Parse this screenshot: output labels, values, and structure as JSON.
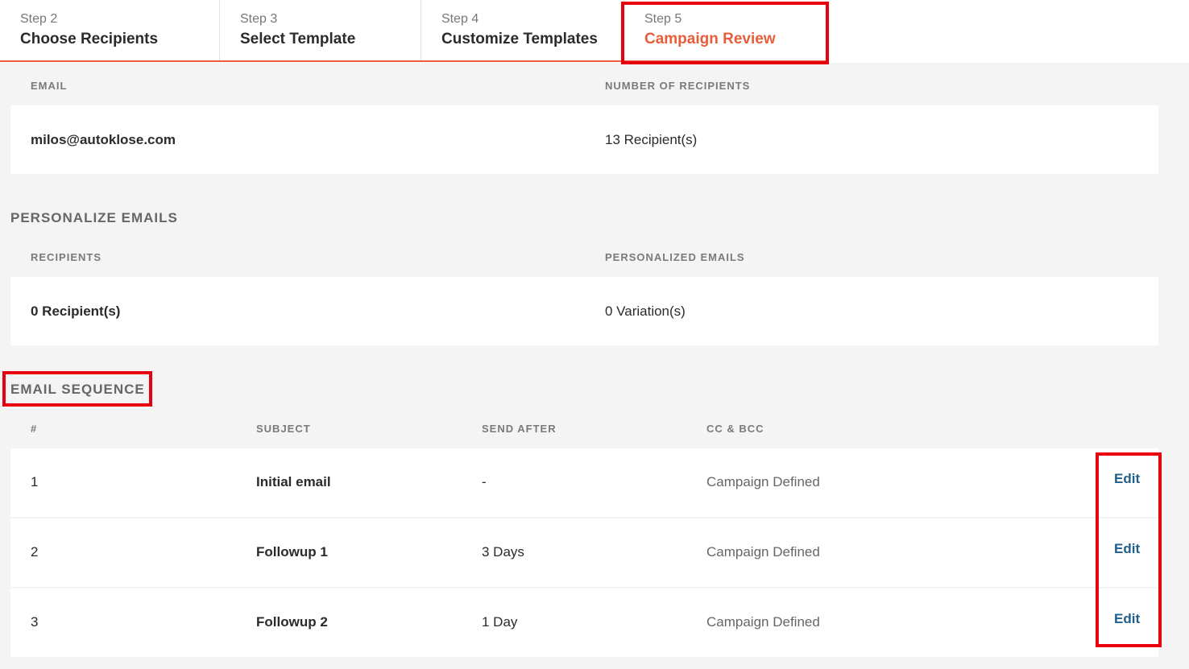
{
  "steps": [
    {
      "num": "Step 2",
      "name": "Choose Recipients"
    },
    {
      "num": "Step 3",
      "name": "Select Template"
    },
    {
      "num": "Step 4",
      "name": "Customize Templates"
    },
    {
      "num": "Step 5",
      "name": "Campaign Review"
    }
  ],
  "recipients_summary": {
    "email_header": "EMAIL",
    "count_header": "NUMBER OF RECIPIENTS",
    "email": "milos@autoklose.com",
    "count": "13 Recipient(s)"
  },
  "personalize": {
    "title": "PERSONALIZE EMAILS",
    "recipients_header": "RECIPIENTS",
    "personalized_header": "PERSONALIZED EMAILS",
    "recipients": "0 Recipient(s)",
    "variations": "0 Variation(s)"
  },
  "sequence": {
    "title": "EMAIL SEQUENCE",
    "headers": {
      "num": "#",
      "subject": "SUBJECT",
      "send_after": "SEND AFTER",
      "cc_bcc": "CC & BCC"
    },
    "rows": [
      {
        "num": "1",
        "subject": "Initial email",
        "send_after": "-",
        "cc_bcc": "Campaign Defined",
        "action": "Edit"
      },
      {
        "num": "2",
        "subject": "Followup 1",
        "send_after": "3 Days",
        "cc_bcc": "Campaign Defined",
        "action": "Edit"
      },
      {
        "num": "3",
        "subject": "Followup 2",
        "send_after": "1 Day",
        "cc_bcc": "Campaign Defined",
        "action": "Edit"
      }
    ]
  },
  "colors": {
    "accent": "#e85d3a",
    "highlight": "#e8000e",
    "link": "#1f5f8b"
  }
}
